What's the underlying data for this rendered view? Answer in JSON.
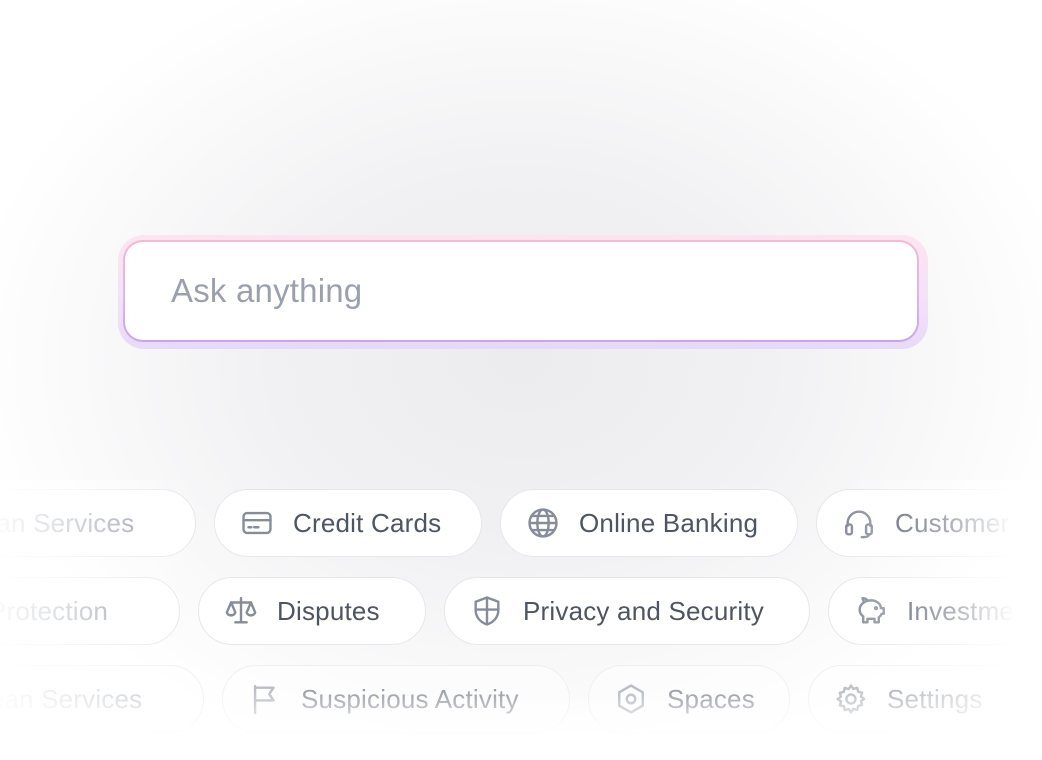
{
  "search": {
    "placeholder": "Ask anything"
  },
  "rows": [
    [
      {
        "label": "Loan Services",
        "icon": "none"
      },
      {
        "label": "Credit Cards",
        "icon": "credit-card-icon"
      },
      {
        "label": "Online Banking",
        "icon": "globe-icon"
      },
      {
        "label": "Customer",
        "icon": "headset-icon"
      }
    ],
    [
      {
        "label": "Protection",
        "icon": "none"
      },
      {
        "label": "Disputes",
        "icon": "scale-icon"
      },
      {
        "label": "Privacy and Security",
        "icon": "shield-icon"
      },
      {
        "label": "Investments",
        "icon": "piggy-bank-icon"
      }
    ],
    [
      {
        "label": "Loan Services",
        "icon": "none"
      },
      {
        "label": "Suspicious Activity",
        "icon": "flag-icon"
      },
      {
        "label": "Spaces",
        "icon": "hexagon-icon"
      },
      {
        "label": "Settings",
        "icon": "gear-icon"
      }
    ]
  ],
  "colors": {
    "chip_text": "#4d5562",
    "icon_stroke": "#868d99",
    "placeholder": "#9aa1ad",
    "border_gradient_top": "#f7b8d2",
    "border_gradient_bottom": "#c8a4ef"
  }
}
